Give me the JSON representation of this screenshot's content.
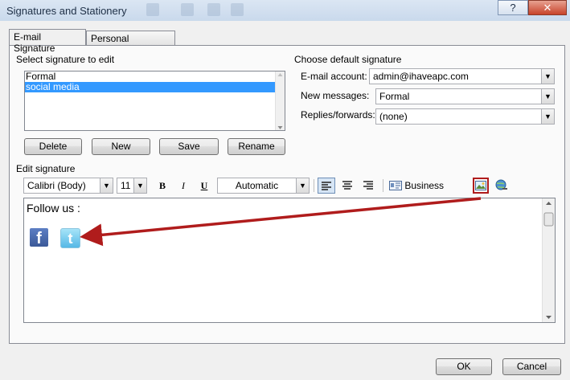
{
  "window": {
    "title": "Signatures and Stationery",
    "help_label": "?",
    "close_label": "✕"
  },
  "tabs": [
    {
      "label": "E-mail Signature",
      "active": true
    },
    {
      "label": "Personal Stationery",
      "active": false
    }
  ],
  "select_signature": {
    "label": "Select signature to edit",
    "items": [
      {
        "label": "Formal",
        "selected": false
      },
      {
        "label": "social media",
        "selected": true
      }
    ]
  },
  "signature_buttons": {
    "delete": "Delete",
    "new": "New",
    "save": "Save",
    "rename": "Rename"
  },
  "default_signature": {
    "label": "Choose default signature",
    "email_account_label": "E-mail account:",
    "email_account_value": "admin@ihaveapc.com",
    "new_messages_label": "New messages:",
    "new_messages_value": "Formal",
    "replies_label": "Replies/forwards:",
    "replies_value": "(none)"
  },
  "edit_signature": {
    "label": "Edit signature",
    "font_value": "Calibri (Body)",
    "size_value": "11",
    "bold": "B",
    "italic": "I",
    "underline": "U",
    "color_value": "Automatic",
    "business_card_label": "Business Card",
    "content_text": "Follow us :",
    "facebook_glyph": "f",
    "twitter_glyph": "t"
  },
  "footer": {
    "ok": "OK",
    "cancel": "Cancel"
  },
  "colors": {
    "selection": "#3399ff",
    "annotation_arrow": "#b01c1c",
    "facebook": "#3b5998",
    "twitter": "#55b8e6"
  }
}
